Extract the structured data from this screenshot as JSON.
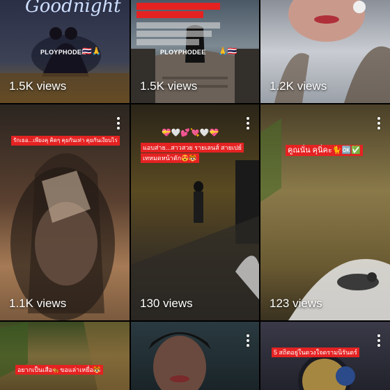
{
  "tiles": [
    {
      "views": "1.5K views",
      "script_title": "Goodnight",
      "brand": "PLOYPHODEE",
      "emojis": "🇹🇭🙏"
    },
    {
      "views": "1.5K views",
      "brand": "PLOYPHODEE",
      "emojis": "🙏🇹🇭"
    },
    {
      "views": "1.2K views"
    },
    {
      "views": "1.1K views",
      "caption": "รักเธอ...เพียงคุ คิดๆ คุยกันเท่า คุยกันเงียบไร"
    },
    {
      "views": "130 views",
      "emojis": "💝🤍💕💘🤍💝",
      "caption_line1": "แอบส่าย...สาวสวย รายเลนส์ สายเปย์",
      "caption_line2": "เทหมดหน้าตัก😍🐯"
    },
    {
      "views": "123 views",
      "caption": "คูณนั่น คุนิ่คะ🐈🆗✅"
    },
    {
      "caption": "อยากเป็นเสือ🐅ขอแล่าเหยื่อ🐯"
    },
    {},
    {
      "caption": "5 สถิตอยู่ในดวงใจดรามนิรันดร์"
    }
  ]
}
